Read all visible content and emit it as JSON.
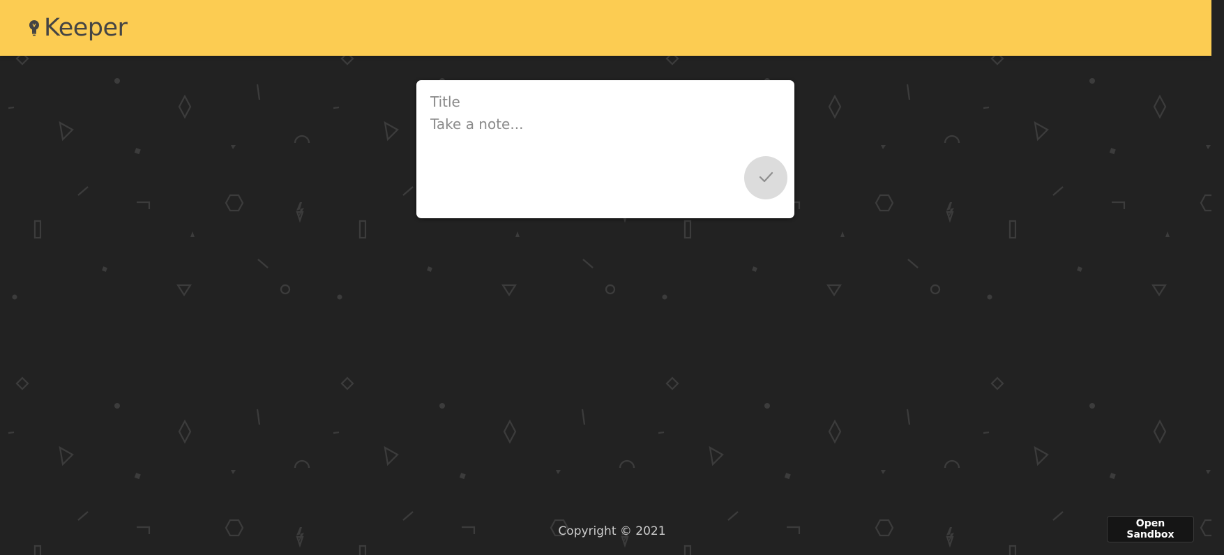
{
  "header": {
    "app_title": "Keeper",
    "logo_icon": "lightbulb-icon",
    "background_color": "#fccc52"
  },
  "note_form": {
    "title_placeholder": "Title",
    "content_placeholder": "Take a note...",
    "add_button_icon": "check-icon"
  },
  "footer": {
    "copyright": "Copyright © 2021"
  },
  "sandbox_button": {
    "label": "Open Sandbox"
  },
  "colors": {
    "page_background": "#222222",
    "pattern_shapes": "#3d3d3d",
    "card_background": "#ffffff",
    "button_background": "#dcdcdc"
  }
}
